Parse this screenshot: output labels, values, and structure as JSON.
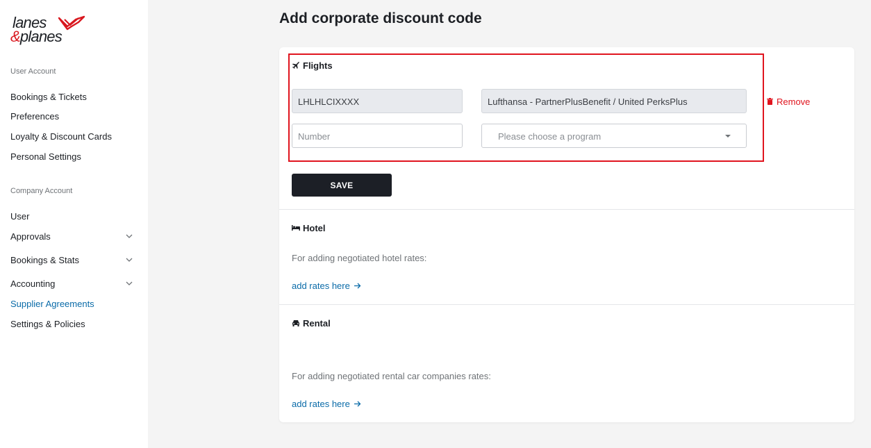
{
  "brand": {
    "line1": "lanes",
    "amp": "&",
    "line2": "planes",
    "accent_color": "#d9181f"
  },
  "sidebar": {
    "user_section_label": "User Account",
    "user_items": [
      {
        "label": "Bookings & Tickets"
      },
      {
        "label": "Preferences"
      },
      {
        "label": "Loyalty & Discount Cards"
      },
      {
        "label": "Personal Settings"
      }
    ],
    "company_section_label": "Company Account",
    "company_items": [
      {
        "label": "User"
      },
      {
        "label": "Approvals"
      },
      {
        "label": "Bookings & Stats"
      },
      {
        "label": "Accounting"
      },
      {
        "label": "Supplier Agreements"
      },
      {
        "label": "Settings & Policies"
      }
    ],
    "active_item": "Supplier Agreements",
    "active_color": "#0a6ba8"
  },
  "page": {
    "title": "Add corporate discount code"
  },
  "flights": {
    "heading": "Flights",
    "icon": "airplane-icon",
    "code_value": "LHLHLCIXXXX",
    "program_value": "Lufthansa - PartnerPlusBenefit / United PerksPlus",
    "remove_label": "Remove",
    "number_placeholder": "Number",
    "program_placeholder": "Please choose a program",
    "highlight_color": "#e0141e"
  },
  "save_label": "SAVE",
  "hotel": {
    "heading": "Hotel",
    "icon": "bed-icon",
    "description": "For adding negotiated hotel rates:",
    "link_label": "add rates here"
  },
  "rental": {
    "heading": "Rental",
    "icon": "car-icon",
    "description": "For adding negotiated rental car companies rates:",
    "link_label": "add rates here"
  }
}
